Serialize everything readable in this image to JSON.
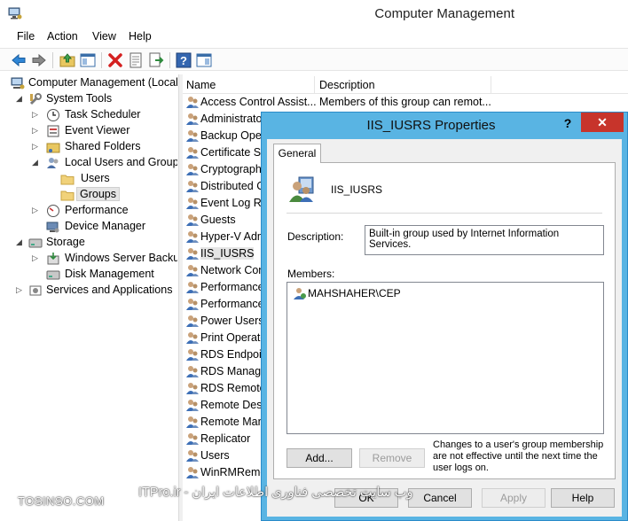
{
  "window": {
    "title": "Computer Management"
  },
  "menu": [
    "File",
    "Action",
    "View",
    "Help"
  ],
  "toolbar": {
    "buttons": [
      "back-arrow-icon",
      "forward-arrow-icon",
      "up-folder-icon",
      "show-tree-icon",
      "delete-icon",
      "properties-icon",
      "export-icon",
      "help-icon",
      "show-action-pane-icon"
    ]
  },
  "tree": {
    "items": [
      {
        "label": "Computer Management (Local",
        "icon": "computer-management-icon"
      },
      {
        "label": "System Tools",
        "icon": "tools-icon"
      },
      {
        "label": "Task Scheduler",
        "icon": "clock-icon"
      },
      {
        "label": "Event Viewer",
        "icon": "event-viewer-icon"
      },
      {
        "label": "Shared Folders",
        "icon": "shared-folder-icon"
      },
      {
        "label": "Local Users and Groups",
        "icon": "users-icon"
      },
      {
        "label": "Users",
        "icon": "folder-icon"
      },
      {
        "label": "Groups",
        "icon": "folder-icon"
      },
      {
        "label": "Performance",
        "icon": "performance-icon"
      },
      {
        "label": "Device Manager",
        "icon": "device-manager-icon"
      },
      {
        "label": "Storage",
        "icon": "storage-icon"
      },
      {
        "label": "Windows Server Backup",
        "icon": "backup-icon"
      },
      {
        "label": "Disk Management",
        "icon": "disk-icon"
      },
      {
        "label": "Services and Applications",
        "icon": "services-icon"
      }
    ]
  },
  "list": {
    "columns": [
      "Name",
      "Description"
    ],
    "rows": [
      {
        "name": "Access Control Assist...",
        "description": "Members of this group can remot..."
      },
      {
        "name": "Administrato",
        "description": ""
      },
      {
        "name": "Backup Oper",
        "description": ""
      },
      {
        "name": "Certificate Se",
        "description": ""
      },
      {
        "name": "Cryptograph",
        "description": ""
      },
      {
        "name": "Distributed C",
        "description": ""
      },
      {
        "name": "Event Log Re",
        "description": ""
      },
      {
        "name": "Guests",
        "description": ""
      },
      {
        "name": "Hyper-V Adm",
        "description": ""
      },
      {
        "name": "IIS_IUSRS",
        "description": ""
      },
      {
        "name": "Network Con",
        "description": ""
      },
      {
        "name": "Performance",
        "description": ""
      },
      {
        "name": "Performance",
        "description": ""
      },
      {
        "name": "Power Users",
        "description": ""
      },
      {
        "name": "Print Operato",
        "description": ""
      },
      {
        "name": "RDS Endpoin",
        "description": ""
      },
      {
        "name": "RDS Manage",
        "description": ""
      },
      {
        "name": "RDS Remote",
        "description": ""
      },
      {
        "name": "Remote Desk",
        "description": ""
      },
      {
        "name": "Remote Man",
        "description": ""
      },
      {
        "name": "Replicator",
        "description": ""
      },
      {
        "name": "Users",
        "description": ""
      },
      {
        "name": "WinRMRemo",
        "description": ""
      }
    ]
  },
  "dialog": {
    "title": "IIS_IUSRS Properties",
    "help": "?",
    "close": "✕",
    "tab": "General",
    "group_name": "IIS_IUSRS",
    "description_label": "Description:",
    "description_value": "Built-in group used by Internet Information Services.",
    "members_label": "Members:",
    "members": [
      "MAHSHAHER\\CEP"
    ],
    "add_label": "Add...",
    "remove_label": "Remove",
    "note": "Changes to a user's group membership are not effective until the next time the user logs on.",
    "ok_label": "OK",
    "cancel_label": "Cancel",
    "apply_label": "Apply",
    "help_label": "Help"
  },
  "watermark": {
    "left": "TOSINSO.COM",
    "right": "وب سایت تخصصی فناوری اطلاعات ایران - ITPro.ir"
  },
  "colors": {
    "dialog_frame": "#59b4e3",
    "close_button": "#c7342b",
    "selection": "#e5e5e5"
  }
}
